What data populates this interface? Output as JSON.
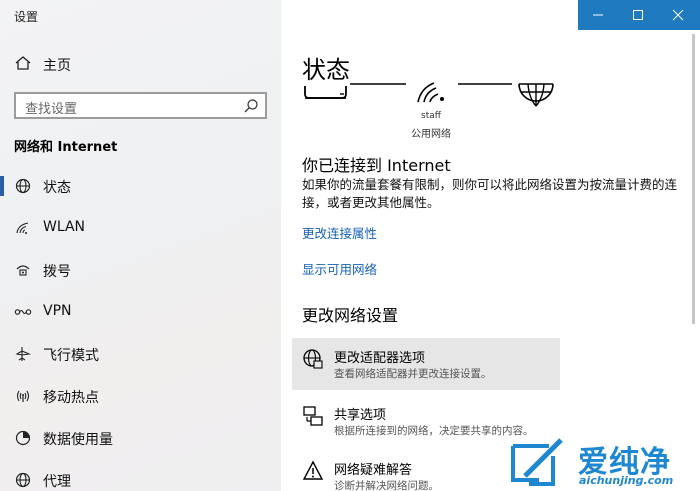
{
  "window": {
    "title": "设置",
    "accent": "#1f7ac0"
  },
  "sidebar": {
    "home_label": "主页",
    "search_placeholder": "查找设置",
    "section_title": "网络和 Internet",
    "items": [
      {
        "label": "状态",
        "icon": "network-status-icon",
        "active": true
      },
      {
        "label": "WLAN",
        "icon": "wifi-icon"
      },
      {
        "label": "拨号",
        "icon": "dialup-icon"
      },
      {
        "label": "VPN",
        "icon": "vpn-icon"
      },
      {
        "label": "飞行模式",
        "icon": "airplane-icon"
      },
      {
        "label": "移动热点",
        "icon": "hotspot-icon"
      },
      {
        "label": "数据使用量",
        "icon": "data-usage-icon"
      },
      {
        "label": "代理",
        "icon": "globe-icon"
      }
    ]
  },
  "main": {
    "title": "状态",
    "network_name": "staff",
    "network_type": "公用网络",
    "connected_heading": "你已连接到 Internet",
    "description": "如果你的流量套餐有限制，则你可以将此网络设置为按流量计费的连接，或者更改其他属性。",
    "link_change_props": "更改连接属性",
    "link_show_networks": "显示可用网络",
    "change_settings_heading": "更改网络设置",
    "options": [
      {
        "title": "更改适配器选项",
        "subtitle": "查看网络适配器并更改连接设置。",
        "icon": "adapter-icon"
      },
      {
        "title": "共享选项",
        "subtitle": "根据所连接到的网络，决定要共享的内容。",
        "icon": "sharing-icon"
      },
      {
        "title": "网络疑难解答",
        "subtitle": "诊断并解决网络问题。",
        "icon": "warning-icon"
      }
    ]
  },
  "watermark": {
    "text": "爱纯净",
    "url": "aichunjing.com",
    "color": "#1e87d2"
  }
}
